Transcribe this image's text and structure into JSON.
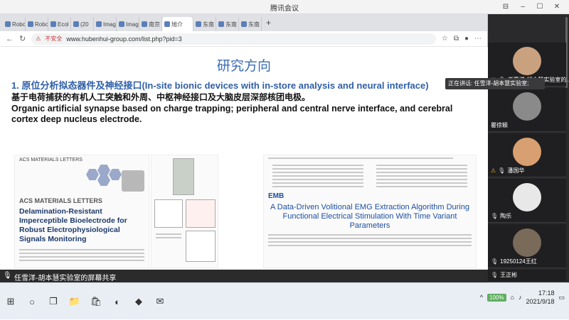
{
  "window": {
    "title": "腾讯会议"
  },
  "browser": {
    "tabs": [
      "Robo",
      "Robo",
      "Ecol",
      "(20",
      "Imag",
      "Imag",
      "南京",
      "旭介",
      "东南",
      "东南",
      "东南"
    ],
    "url": "www.hubenhui-group.com/list.php?pid=3",
    "security_label": "不安全"
  },
  "slide": {
    "heading": "研究方向",
    "subtitle_blue": "1. 原位分析拟态器件及神经接口(In-site bionic devices with in-store analysis and neural interface)",
    "subtitle_cn": "基于电荷捕获的有机人工突触和外周、中枢神经接口及大脑皮层深部核团电极。",
    "subtitle_en": "Organic artificial synapse based on charge trapping; peripheral and central nerve interface, and cerebral cortex deep nucleus electrode.",
    "paper1": {
      "journal_head": "ACS MATERIALS LETTERS",
      "logo": "ACS MATERIALS LETTERS",
      "title": "Delamination-Resistant Imperceptible Bioelectrode for Robust Electrophysiological Signals Monitoring"
    },
    "paper2": {
      "logo": "EMB",
      "title": "A Data-Driven Volitional EMG Extraction Algorithm During Functional Electrical Stimulation With Time Variant Parameters"
    }
  },
  "speaker_bar": {
    "text": "任雪洋-胡本慧实验室的屏幕共享"
  },
  "participants": [
    {
      "name": "任雪洋-胡本慧实验室的...",
      "speaking": true
    },
    {
      "name": "瞿徐颖",
      "speaking": false
    },
    {
      "name": "潘国华",
      "speaking": false
    },
    {
      "name": "陶乐",
      "speaking": false
    },
    {
      "name": "19250124王红",
      "speaking": false
    },
    {
      "name": "王正彬",
      "speaking": false
    }
  ],
  "tooltip": "正在讲话: 任雪洋-胡本慧实验室;",
  "taskbar": {
    "battery": "100%",
    "time": "17:18",
    "date": "2021/9/18"
  }
}
